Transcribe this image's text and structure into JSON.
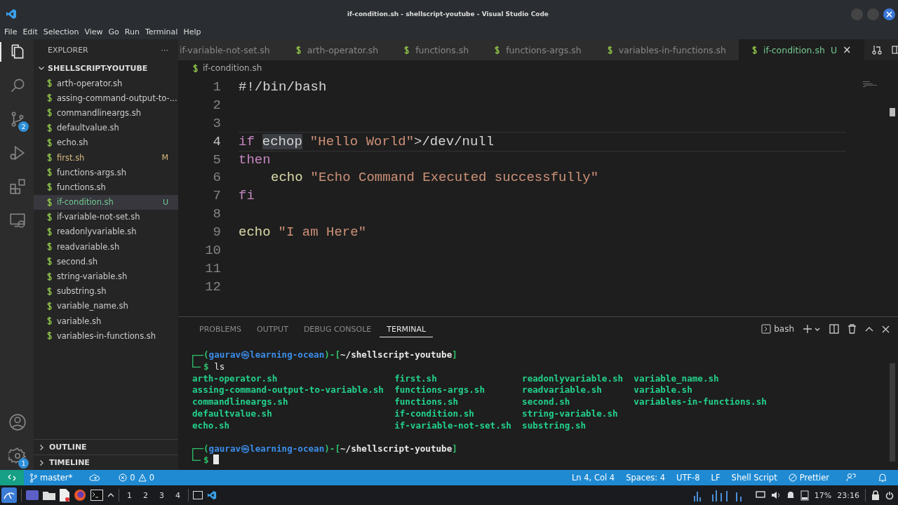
{
  "window": {
    "title": "if-condition.sh - shellscript-youtube - Visual Studio Code"
  },
  "menu": [
    "File",
    "Edit",
    "Selection",
    "View",
    "Go",
    "Run",
    "Terminal",
    "Help"
  ],
  "activity_bar": {
    "top": [
      {
        "kind": "explorer",
        "selected": true
      },
      {
        "kind": "search",
        "selected": false
      },
      {
        "kind": "source-control",
        "selected": false,
        "badge": "2"
      },
      {
        "kind": "run",
        "selected": false
      },
      {
        "kind": "extensions",
        "selected": false
      },
      {
        "kind": "remote",
        "selected": false
      }
    ],
    "bottom": [
      {
        "kind": "account",
        "selected": false
      },
      {
        "kind": "settings",
        "selected": false,
        "badge": "1"
      }
    ]
  },
  "sidebar": {
    "title": "EXPLORER",
    "more": "···",
    "folder": {
      "name": "SHELLSCRIPT-YOUTUBE",
      "expanded": true
    },
    "files": [
      {
        "name": "arth-operator.sh",
        "kind": "normal",
        "selected": false
      },
      {
        "name": "assing-command-output-to-...",
        "kind": "normal",
        "selected": false
      },
      {
        "name": "commandlineargs.sh",
        "kind": "normal",
        "selected": false
      },
      {
        "name": "defaultvalue.sh",
        "kind": "normal",
        "selected": false
      },
      {
        "name": "echo.sh",
        "kind": "normal",
        "selected": false
      },
      {
        "name": "first.sh",
        "kind": "modified",
        "status": "M",
        "selected": false
      },
      {
        "name": "functions-args.sh",
        "kind": "normal",
        "selected": false
      },
      {
        "name": "functions.sh",
        "kind": "normal",
        "selected": false
      },
      {
        "name": "if-condition.sh",
        "kind": "untracked",
        "status": "U",
        "selected": true
      },
      {
        "name": "if-variable-not-set.sh",
        "kind": "normal",
        "selected": false
      },
      {
        "name": "readonlyvariable.sh",
        "kind": "normal",
        "selected": false
      },
      {
        "name": "readvariable.sh",
        "kind": "normal",
        "selected": false
      },
      {
        "name": "second.sh",
        "kind": "normal",
        "selected": false
      },
      {
        "name": "string-variable.sh",
        "kind": "normal",
        "selected": false
      },
      {
        "name": "substring.sh",
        "kind": "normal",
        "selected": false
      },
      {
        "name": "variable_name.sh",
        "kind": "normal",
        "selected": false
      },
      {
        "name": "variable.sh",
        "kind": "normal",
        "selected": false
      },
      {
        "name": "variables-in-functions.sh",
        "kind": "normal",
        "selected": false
      }
    ],
    "sections": [
      {
        "name": "OUTLINE",
        "expanded": false
      },
      {
        "name": "TIMELINE",
        "expanded": false
      }
    ]
  },
  "tabs": [
    {
      "label": "if-variable-not-set.sh",
      "selected": false,
      "icon": false
    },
    {
      "label": "arth-operator.sh",
      "selected": false,
      "icon": true
    },
    {
      "label": "functions.sh",
      "selected": false,
      "icon": true
    },
    {
      "label": "functions-args.sh",
      "selected": false,
      "icon": true
    },
    {
      "label": "variables-in-functions.sh",
      "selected": false,
      "icon": true
    },
    {
      "label": "if-condition.sh",
      "selected": true,
      "icon": true,
      "status": "U",
      "close": "×"
    }
  ],
  "breadcrumb": "if-condition.sh",
  "code": [
    {
      "number": "1",
      "current": false,
      "indented": false,
      "tokens": [
        {
          "text": "#!/bin/bash",
          "kind": "comment"
        }
      ]
    },
    {
      "number": "2",
      "current": false,
      "indented": false
    },
    {
      "number": "3",
      "current": false,
      "indented": false
    },
    {
      "number": "4",
      "current": true,
      "indented": false,
      "tokens": [
        {
          "text": "if",
          "kind": "keyword"
        },
        {
          "text": "echop",
          "kind": "match"
        },
        {
          "text": "\"Hello World\"",
          "kind": "string"
        },
        {
          "text": ">/dev/null",
          "kind": "plain"
        }
      ]
    },
    {
      "number": "5",
      "current": false,
      "indented": false,
      "tokens": [
        {
          "text": "then",
          "kind": "keyword"
        }
      ]
    },
    {
      "number": "6",
      "current": false,
      "indented": true,
      "tokens": [
        {
          "text": "echo",
          "kind": "builtin"
        },
        {
          "text": "\"Echo Command Executed successfully\"",
          "kind": "string"
        }
      ]
    },
    {
      "number": "7",
      "current": false,
      "indented": false,
      "tokens": [
        {
          "text": "fi",
          "kind": "keyword"
        }
      ]
    },
    {
      "number": "8",
      "current": false,
      "indented": false
    },
    {
      "number": "9",
      "current": false,
      "indented": false,
      "tokens": [
        {
          "text": "echo",
          "kind": "builtin"
        },
        {
          "text": "\"I am Here\"",
          "kind": "string"
        }
      ]
    },
    {
      "number": "10",
      "current": false,
      "indented": false
    },
    {
      "number": "11",
      "current": false,
      "indented": false
    },
    {
      "number": "12",
      "current": false,
      "indented": false
    }
  ],
  "panel": {
    "tabs": [
      {
        "label": "PROBLEMS",
        "selected": false
      },
      {
        "label": "OUTPUT",
        "selected": false
      },
      {
        "label": "DEBUG CONSOLE",
        "selected": false
      },
      {
        "label": "TERMINAL",
        "selected": true
      }
    ],
    "shell": "bash",
    "terminal": [
      {
        "kind": "prompt",
        "open": "(",
        "user": "gaurav",
        "symbol": "㉿",
        "host": "learning-ocean",
        "mid": ")-[",
        "path": "~/shellscript-youtube",
        "close": "]",
        "sign": "$",
        "command": "ls"
      },
      {
        "kind": "listing",
        "columns": [
          [
            "arth-operator.sh",
            "assing-command-output-to-variable.sh",
            "commandlineargs.sh",
            "defaultvalue.sh",
            "echo.sh"
          ],
          [
            "first.sh",
            "functions-args.sh",
            "functions.sh",
            "if-condition.sh",
            "if-variable-not-set.sh"
          ],
          [
            "readonlyvariable.sh",
            "readvariable.sh",
            "second.sh",
            "string-variable.sh",
            "substring.sh"
          ],
          [
            "variable_name.sh",
            "variable.sh",
            "variables-in-functions.sh"
          ]
        ]
      },
      {
        "kind": "prompt",
        "open": "(",
        "user": "gaurav",
        "symbol": "㉿",
        "host": "learning-ocean",
        "mid": ")-[",
        "path": "~/shellscript-youtube",
        "close": "]",
        "sign": "$",
        "cursor": true
      }
    ]
  },
  "status_bar": {
    "branch": "master*",
    "errors": "0",
    "warnings": "0",
    "right": [
      "Ln 4, Col 4",
      "Spaces: 4",
      "UTF-8",
      "LF",
      "Shell Script",
      "Prettier"
    ]
  },
  "taskbar": {
    "workspaces": [
      "1",
      "2",
      "3",
      "4"
    ],
    "battery": "17%",
    "clock": "23:16"
  }
}
